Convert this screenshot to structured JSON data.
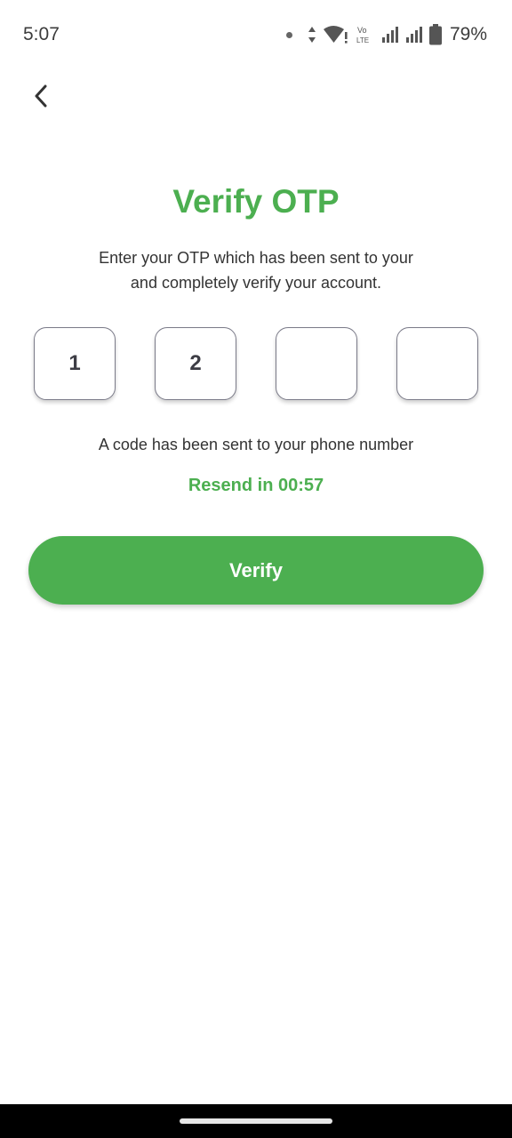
{
  "status_bar": {
    "time": "5:07",
    "volte_label_top": "Vo",
    "volte_label_bottom": "LTE",
    "battery": "79%"
  },
  "screen": {
    "title": "Verify OTP",
    "subtitle_line1": "Enter your OTP which has been sent to your",
    "subtitle_line2": "and completely verify your account.",
    "otp_digits": [
      "1",
      "2",
      "",
      ""
    ],
    "info_text": "A code has been sent to your phone number",
    "resend_text": "Resend in 00:57",
    "verify_label": "Verify"
  },
  "colors": {
    "accent": "#4caf50",
    "box_border": "#7a7a88"
  },
  "icons": {
    "back": "chevron-left-icon"
  }
}
